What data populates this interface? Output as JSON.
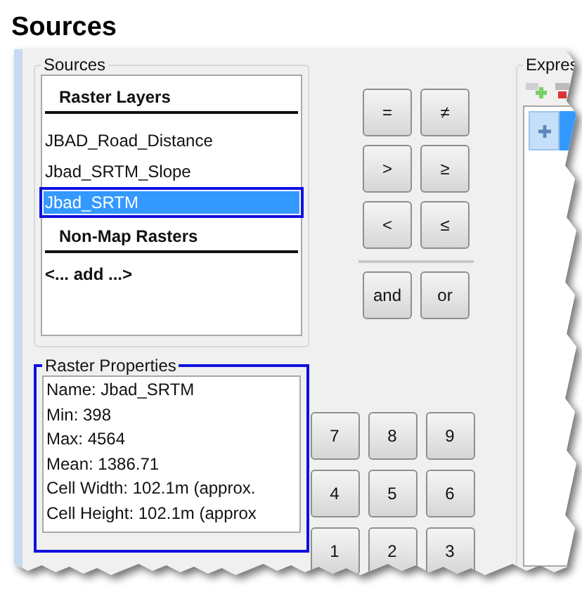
{
  "page_title": "Sources",
  "sources": {
    "title": "Sources",
    "items": [
      {
        "kind": "header",
        "label": "Raster Layers"
      },
      {
        "kind": "item",
        "label": "JBAD_Road_Distance",
        "selected": false,
        "highlighted": false
      },
      {
        "kind": "item",
        "label": "Jbad_SRTM_Slope",
        "selected": false,
        "highlighted": false
      },
      {
        "kind": "item",
        "label": "Jbad_SRTM",
        "selected": true,
        "highlighted": true
      },
      {
        "kind": "header",
        "label": "Non-Map Rasters"
      },
      {
        "kind": "add",
        "label": "<... add ...>"
      }
    ]
  },
  "operators": [
    [
      "=",
      "≠"
    ],
    [
      ">",
      "≥"
    ],
    [
      "<",
      "≤"
    ]
  ],
  "logic": [
    "and",
    "or"
  ],
  "digits": [
    [
      "7",
      "8",
      "9"
    ],
    [
      "4",
      "5",
      "6"
    ],
    [
      "1",
      "2",
      "3"
    ]
  ],
  "raster_properties": {
    "title": "Raster Properties",
    "highlighted": true,
    "lines": [
      "Name: Jbad_SRTM",
      "Min: 398",
      "Max: 4564",
      "Mean: 1386.71",
      "Cell Width: 102.1m (approx.",
      "Cell Height: 102.1m (approx"
    ]
  },
  "expression": {
    "title": "Expres"
  }
}
